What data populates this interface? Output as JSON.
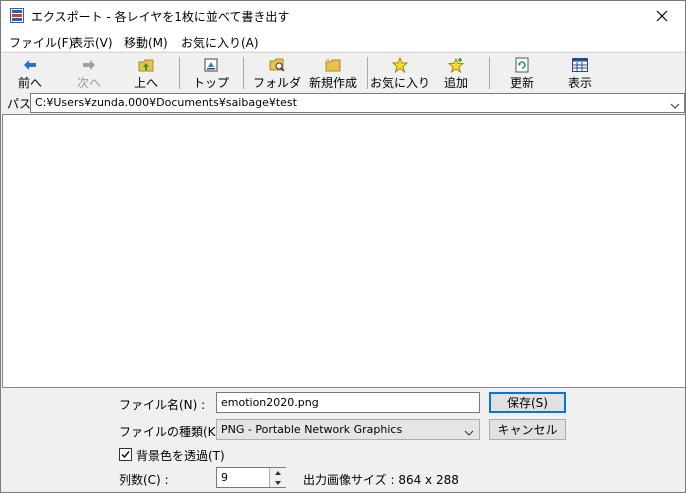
{
  "window": {
    "title": "エクスポート - 各レイヤを1枚に並べて書き出す"
  },
  "menu": [
    {
      "label": "ファイル(F)"
    },
    {
      "label": "表示(V)"
    },
    {
      "label": "移動(M)"
    },
    {
      "label": "お気に入り(A)"
    }
  ],
  "toolbar": {
    "back": "前へ",
    "forward": "次へ",
    "up": "上へ",
    "top": "トップ",
    "folder": "フォルダ",
    "new": "新規作成",
    "favorites": "お気に入り",
    "add": "追加",
    "refresh": "更新",
    "view": "表示"
  },
  "path": {
    "label": "パス",
    "value": "C:¥Users¥zunda.000¥Documents¥saibage¥test"
  },
  "form": {
    "filename_label": "ファイル名(N) :",
    "filename_value": "emotion2020.png",
    "save_label": "保存(S)",
    "filetype_label": "ファイルの種類(K) :",
    "filetype_value": "PNG - Portable Network Graphics",
    "cancel_label": "キャンセル",
    "transparent_label": "背景色を透過(T)",
    "transparent_checked": true,
    "columns_label": "列数(C) :",
    "columns_value": "9",
    "output_size": "出力画像サイズ : 864 x 288"
  }
}
